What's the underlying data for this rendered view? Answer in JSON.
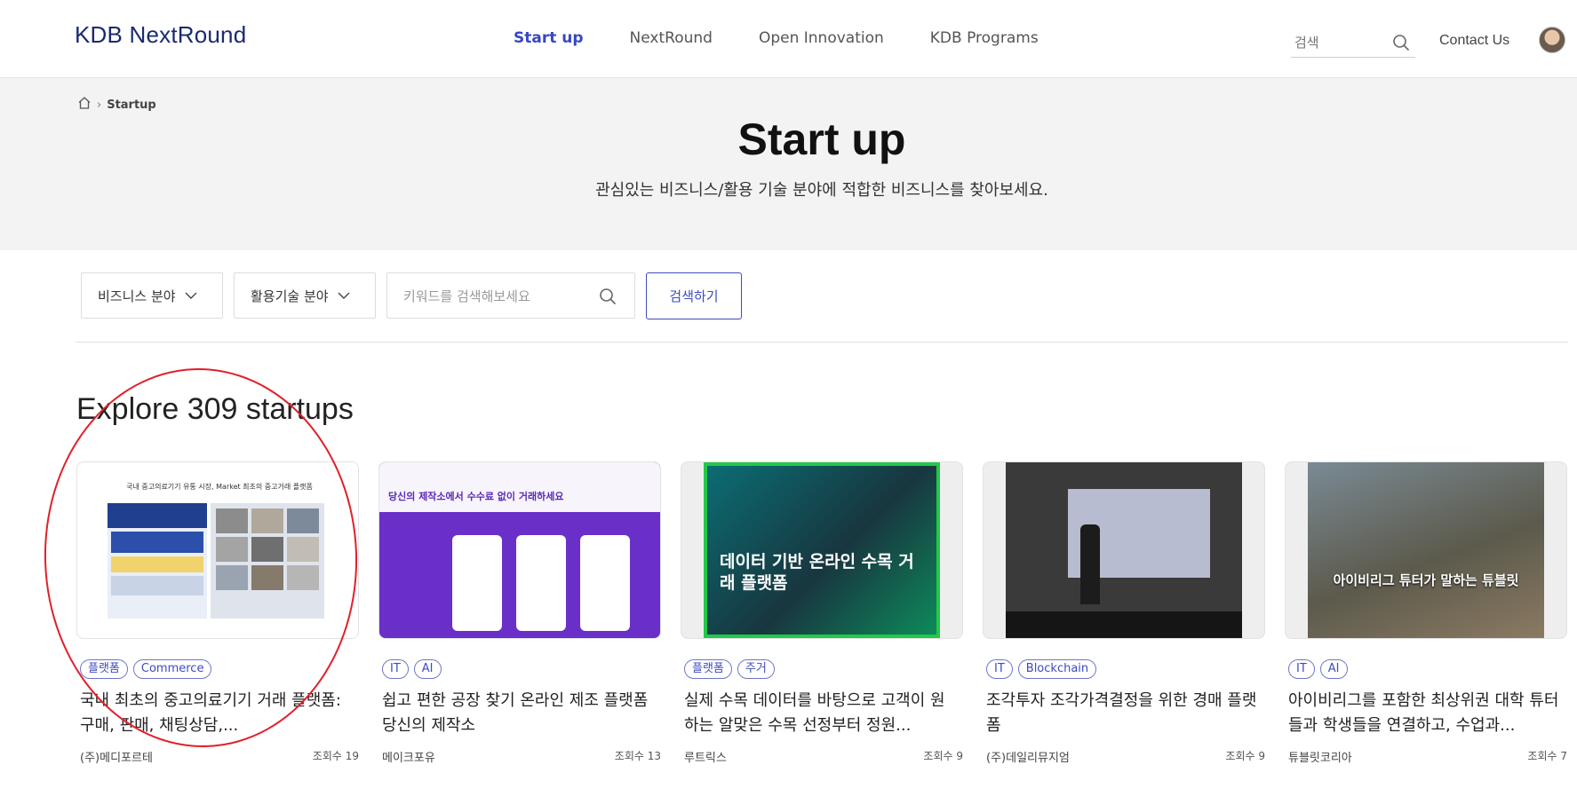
{
  "header": {
    "logo": "KDB NextRound",
    "nav": [
      "Start up",
      "NextRound",
      "Open Innovation",
      "KDB Programs"
    ],
    "search_placeholder": "검색",
    "contact": "Contact Us",
    "accent_color": "#3847c4"
  },
  "breadcrumb": {
    "current": "Startup"
  },
  "hero": {
    "title": "Start up",
    "subtitle": "관심있는 비즈니스/활용 기술 분야에 적합한 비즈니스를 찾아보세요."
  },
  "filters": {
    "business": "비즈니스 분야",
    "tech": "활용기술 분야",
    "keyword_placeholder": "키워드를 검색해보세요",
    "search_button": "검색하기"
  },
  "explore_title": "Explore 309 startups",
  "cards": [
    {
      "tags": [
        "플랫폼",
        "Commerce"
      ],
      "title": "국내 최초의 중고의료기기 거래 플랫폼: 구매, 판매, 채팅상담,...",
      "company": "(주)메디포르테",
      "views": "조회수 19",
      "thumb_text": "국내 중고의료기기 유통 시장, Market 최초의 중고거래 플랫폼"
    },
    {
      "tags": [
        "IT",
        "AI"
      ],
      "title": "쉽고 편한 공장 찾기 온라인 제조 플랫폼 당신의 제작소",
      "company": "메이크포유",
      "views": "조회수 13",
      "thumb_text": "당신의 제작소에서 수수료 없이 거래하세요"
    },
    {
      "tags": [
        "플랫폼",
        "주거"
      ],
      "title": "실제 수목 데이터를 바탕으로 고객이 원하는 알맞은 수목 선정부터 정원...",
      "company": "루트릭스",
      "views": "조회수 9",
      "thumb_text": "데이터 기반 온라인 수목 거래 플랫폼"
    },
    {
      "tags": [
        "IT",
        "Blockchain"
      ],
      "title": "조각투자 조각가격결정을 위한 경매 플랫폼",
      "company": "(주)데일리뮤지엄",
      "views": "조회수 9",
      "thumb_text": ""
    },
    {
      "tags": [
        "IT",
        "AI"
      ],
      "title": "아이비리그를 포함한 최상위권 대학 튜터들과 학생들을 연결하고, 수업과...",
      "company": "튜블릿코리아",
      "views": "조회수 7",
      "thumb_text": "아이비리그 튜터가 말하는 튜블릿"
    }
  ]
}
